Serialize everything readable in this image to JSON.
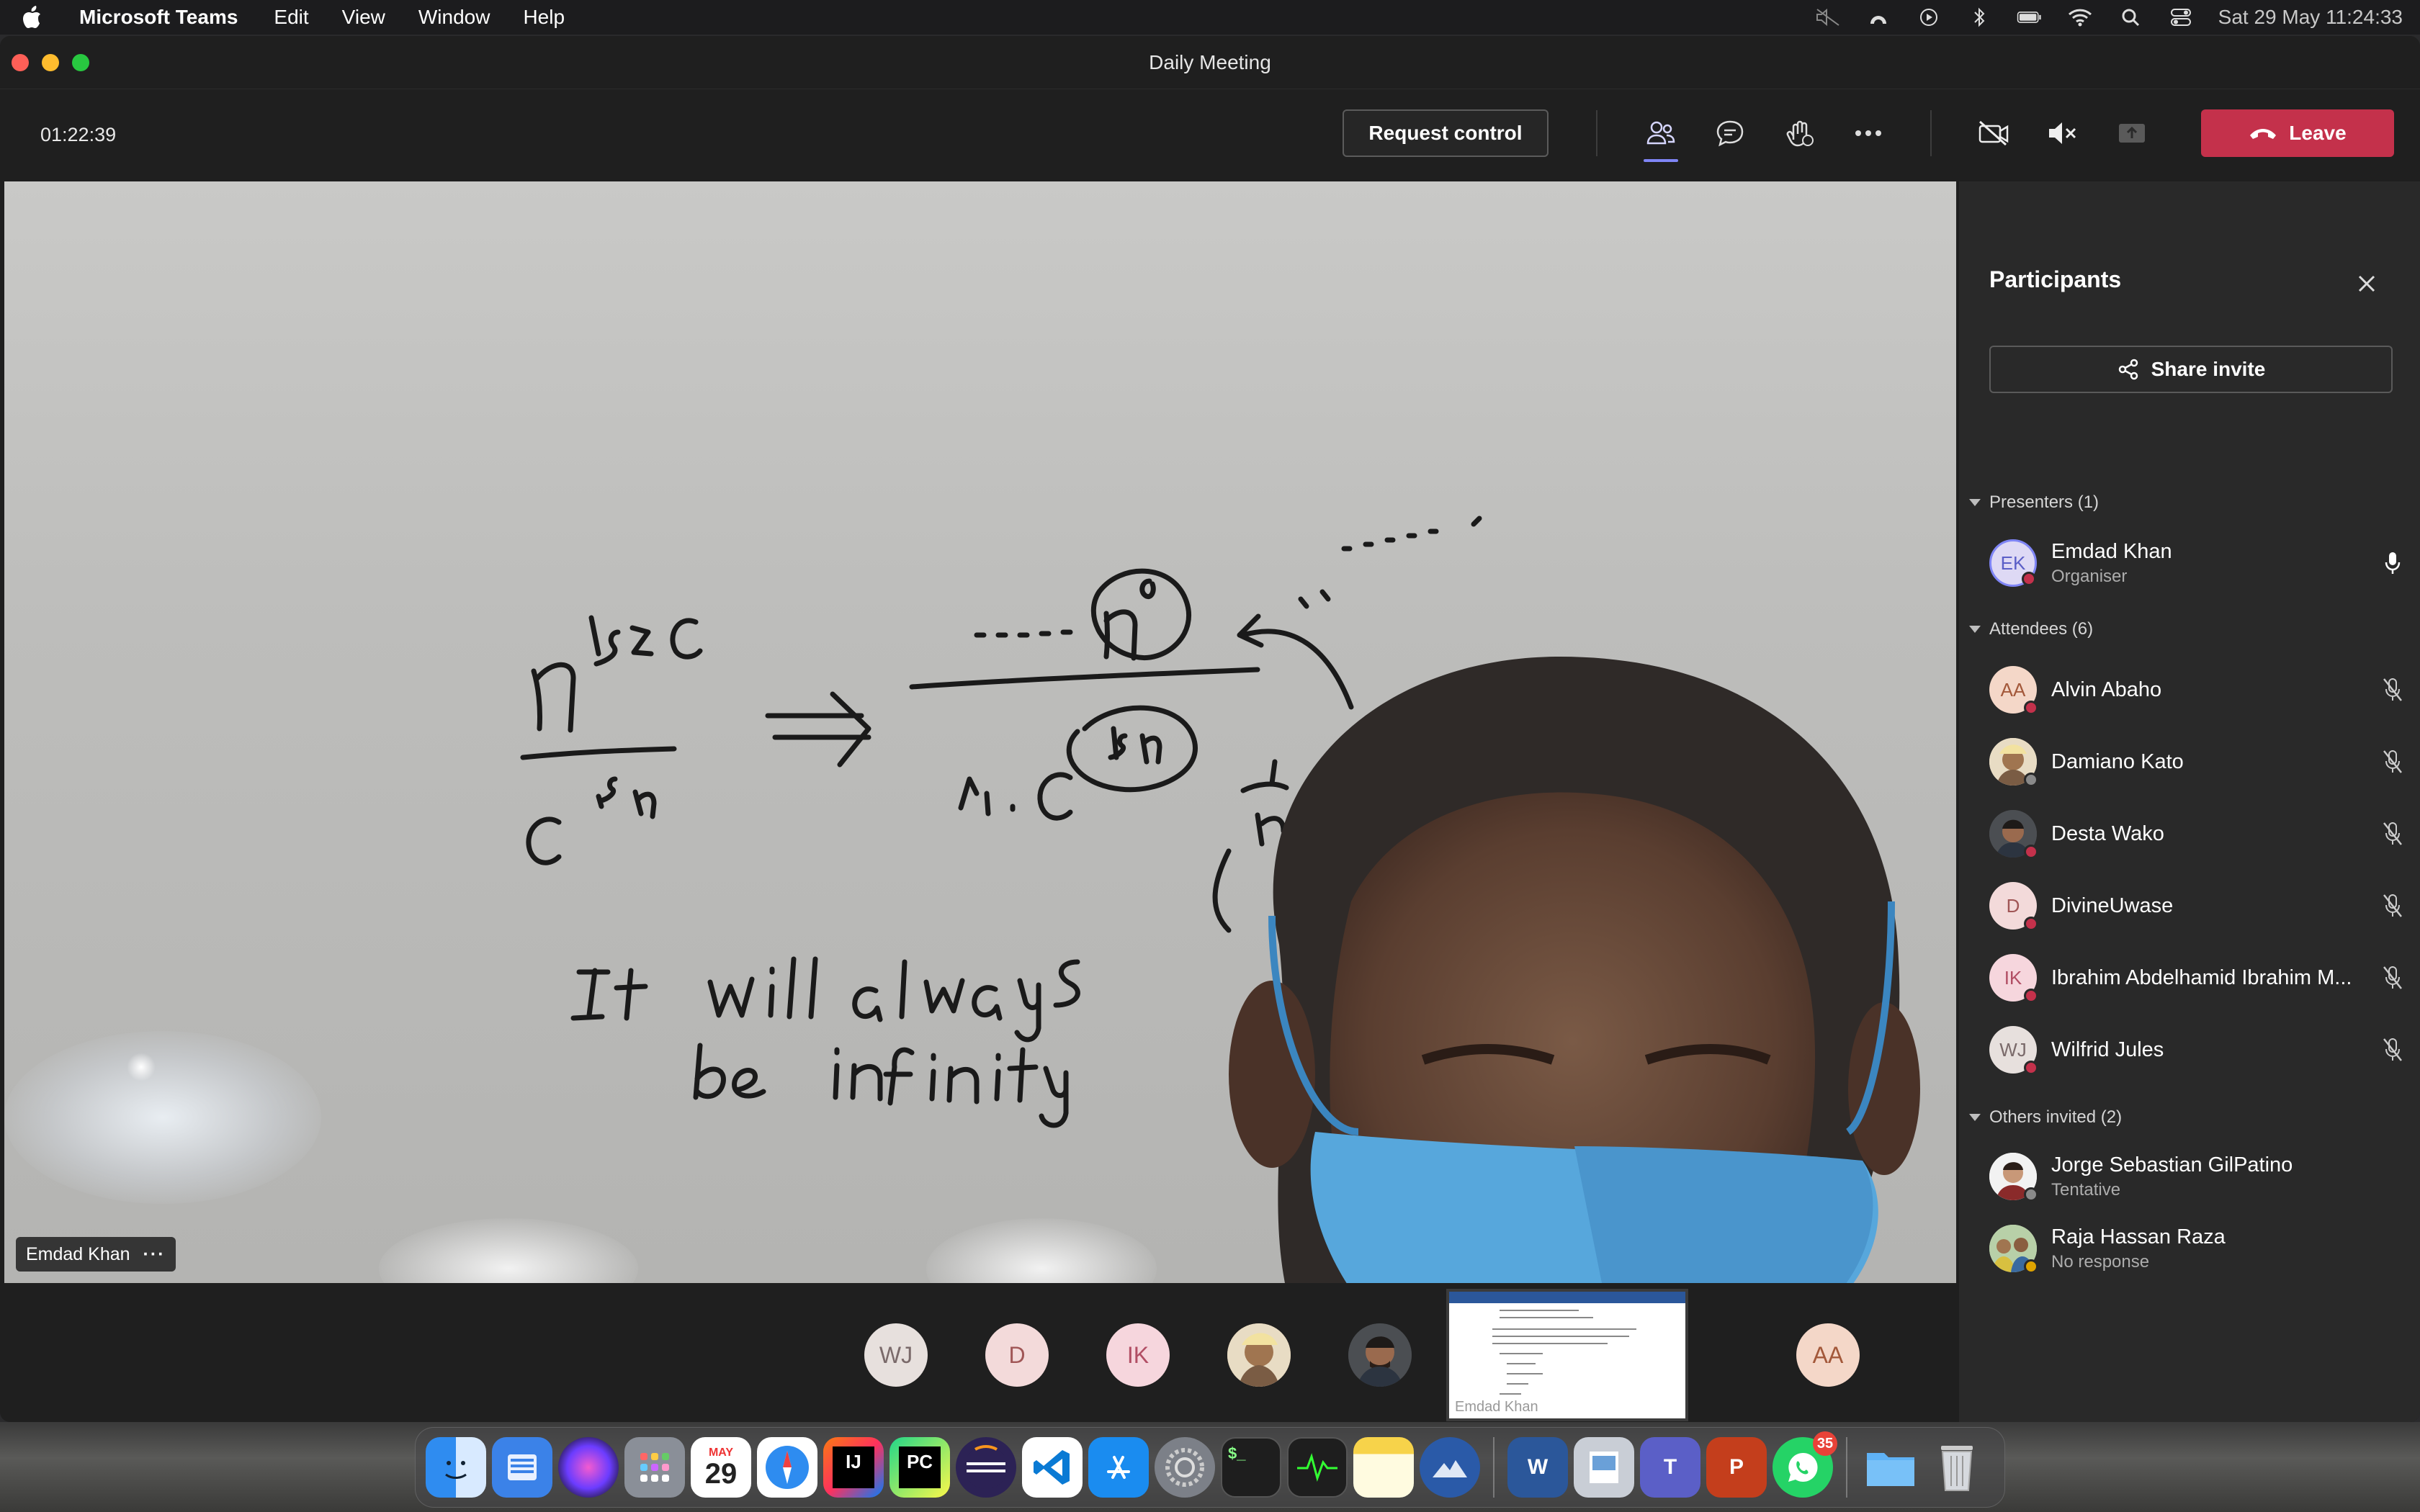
{
  "menubar": {
    "app_name": "Microsoft Teams",
    "menus": [
      "Edit",
      "View",
      "Window",
      "Help"
    ],
    "clock": "Sat 29 May  11:24:33"
  },
  "window": {
    "title": "Daily Meeting"
  },
  "toolbar": {
    "timer": "01:22:39",
    "request_control": "Request control",
    "leave": "Leave"
  },
  "stage": {
    "presenter_label": "Emdad Khan",
    "more_glyph": "···",
    "whiteboard_text": {
      "line1": "It will always",
      "line2": "be infinity"
    }
  },
  "strip": {
    "avatars": [
      "WJ",
      "D",
      "IK",
      "AA"
    ],
    "share_name": "Emdad Khan"
  },
  "panel": {
    "title": "Participants",
    "share_invite": "Share invite",
    "presenters_heading": "Presenters (1)",
    "attendees_heading": "Attendees (6)",
    "others_heading": "Others invited (2)",
    "presenters": [
      {
        "initials": "EK",
        "name": "Emdad Khan",
        "sub": "Organiser"
      }
    ],
    "attendees": [
      {
        "initials": "AA",
        "name": "Alvin Abaho"
      },
      {
        "initials": "",
        "name": "Damiano Kato"
      },
      {
        "initials": "",
        "name": "Desta Wako"
      },
      {
        "initials": "D",
        "name": "DivineUwase"
      },
      {
        "initials": "IK",
        "name": "Ibrahim Abdelhamid Ibrahim M..."
      },
      {
        "initials": "WJ",
        "name": "Wilfrid Jules"
      }
    ],
    "others": [
      {
        "name": "Jorge Sebastian GilPatino",
        "sub": "Tentative"
      },
      {
        "name": "Raja Hassan Raza",
        "sub": "No response"
      }
    ]
  },
  "dock": {
    "calendar_month": "MAY",
    "calendar_day": "29",
    "whatsapp_badge": "35",
    "apps": [
      "finder",
      "files",
      "siri",
      "launchpad",
      "calendar",
      "safari",
      "intellij",
      "pycharm",
      "eclipse",
      "vscode",
      "app-store",
      "system-preferences",
      "terminal",
      "activity-monitor",
      "notes",
      "macos-installer",
      "word",
      "preview",
      "teams",
      "powerpoint",
      "whatsapp",
      "downloads-folder",
      "trash"
    ]
  },
  "colors": {
    "leave": "#c4314b",
    "accent": "#7f85f5",
    "panel_bg": "#292929",
    "presence_busy": "#c4314b"
  }
}
